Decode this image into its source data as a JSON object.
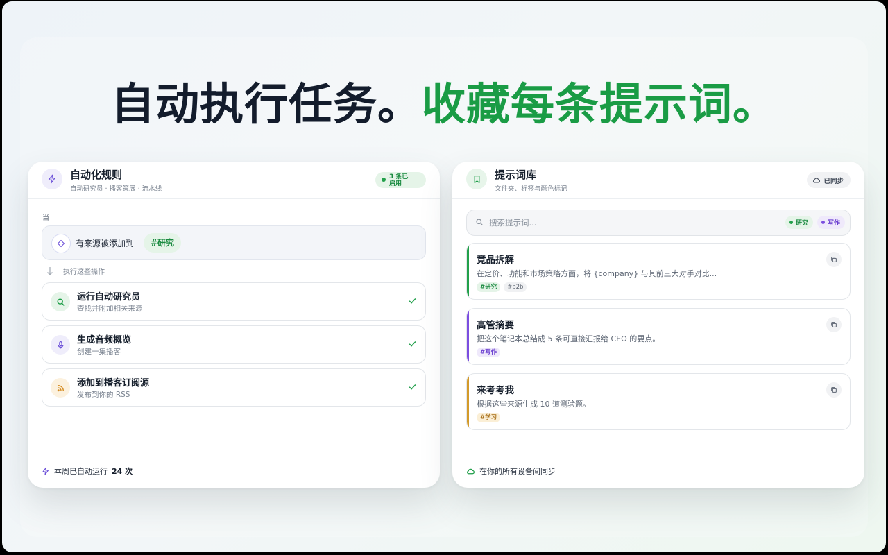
{
  "headline": {
    "part1": "自动执行任务。",
    "part2": "收藏每条提示词。"
  },
  "colors": {
    "accent_green": "#1a9c45",
    "dark_text": "#131c2c",
    "violet": "#7c4ee0",
    "amber": "#d39a2a"
  },
  "automation": {
    "icon": "lightning-icon",
    "title": "自动化规则",
    "subtitle": "自动研究员 · 播客策展 · 流水线",
    "status": "3 条已启用",
    "when_label": "当",
    "trigger": {
      "icon": "diamond-icon",
      "text": "有来源被添加到",
      "tag": "#研究"
    },
    "then_label": "执行这些操作",
    "actions": [
      {
        "icon": "search-icon",
        "title": "运行自动研究员",
        "subtitle": "查找并附加相关来源"
      },
      {
        "icon": "mic-icon",
        "title": "生成音频概览",
        "subtitle": "创建一集播客"
      },
      {
        "icon": "rss-icon",
        "title": "添加到播客订阅源",
        "subtitle": "发布到你的 RSS"
      }
    ],
    "footer_prefix": "本周已自动运行",
    "footer_count": "24 次"
  },
  "prompts": {
    "icon": "bookmark-icon",
    "title": "提示词库",
    "subtitle": "文件夹、标签与颜色标记",
    "sync_status": "已同步",
    "search": {
      "placeholder": "搜索提示词...",
      "chips": [
        "研究",
        "写作"
      ]
    },
    "items": [
      {
        "title": "竞品拆解",
        "text": "在定价、功能和市场策略方面，将 {company} 与其前三大对手对比...",
        "tags": [
          "#研究",
          "#b2b"
        ],
        "color": "#22a04a"
      },
      {
        "title": "高管摘要",
        "text": "把这个笔记本总结成 5 条可直接汇报给 CEO 的要点。",
        "tags": [
          "#写作"
        ],
        "color": "#7c4ee0"
      },
      {
        "title": "来考考我",
        "text": "根据这些来源生成 10 道测验题。",
        "tags": [
          "#学习"
        ],
        "color": "#d39a2a"
      }
    ],
    "footer": "在你的所有设备间同步"
  }
}
